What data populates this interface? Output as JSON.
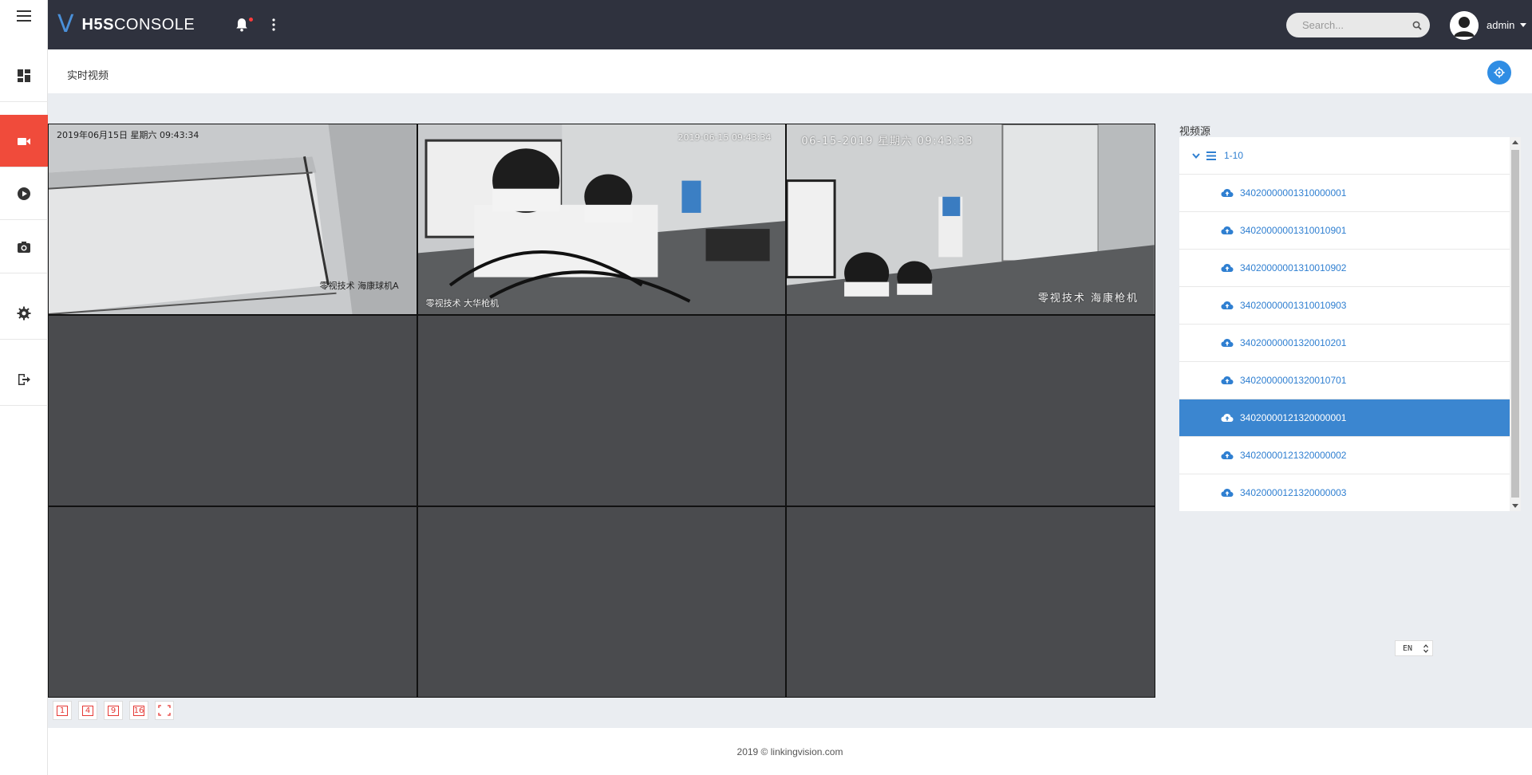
{
  "app": {
    "logo_mark": "V",
    "logo_bold": "H5S",
    "logo_rest": "CONSOLE"
  },
  "header": {
    "search_placeholder": "Search...",
    "user_name": "admin",
    "notification_dot_color": "#ff3b3b"
  },
  "sidebar": {
    "items": [
      {
        "icon": "dashboard-icon",
        "active": false
      },
      {
        "icon": "video-camera-icon",
        "active": true
      },
      {
        "icon": "play-circle-icon",
        "active": false
      },
      {
        "icon": "camera-icon",
        "active": false
      },
      {
        "icon": "gear-icon",
        "active": false
      },
      {
        "icon": "logout-icon",
        "active": false
      }
    ],
    "active_color": "#f04b3b"
  },
  "page": {
    "title": "实时视频"
  },
  "video_grid": {
    "cells": [
      {
        "osd_top": "2019年06月15日  星期六  09:43:34",
        "osd_bottom": "零视技术  海康球机A"
      },
      {
        "osd_top": "2019-06-15 09:43:34",
        "osd_bottom": "零视技术 大华枪机"
      },
      {
        "osd_top": "06-15-2019  星期六  09:43:33",
        "osd_bottom": "零视技术  海康枪机"
      },
      {},
      {},
      {},
      {},
      {},
      {}
    ]
  },
  "layout_buttons": [
    {
      "label": "1"
    },
    {
      "label": "4"
    },
    {
      "label": "9"
    },
    {
      "label": "16"
    },
    {
      "label": "fullscreen-icon"
    }
  ],
  "source_panel": {
    "label": "视频源",
    "root": "1-10",
    "items": [
      "34020000001310000001",
      "34020000001310010901",
      "34020000001310010902",
      "34020000001310010903",
      "34020000001320010201",
      "34020000001320010701",
      "34020000121320000001",
      "34020000121320000002",
      "34020000121320000003"
    ],
    "selected_index": 6,
    "accent_color": "#3b86d0"
  },
  "language": {
    "selected": "EN"
  },
  "footer": {
    "text": "2019 © linkingvision.com"
  }
}
